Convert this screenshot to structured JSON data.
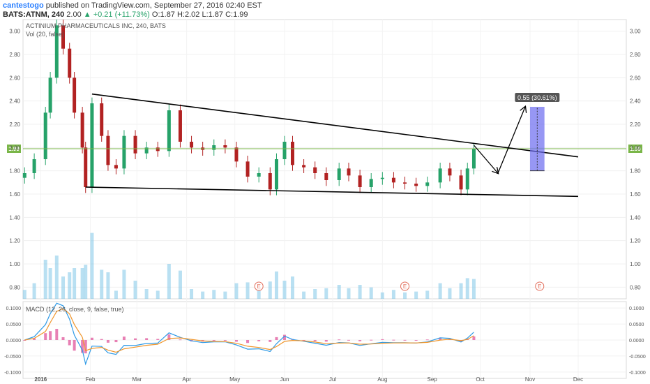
{
  "header": {
    "author": "cantestogo",
    "published": "published on TradingView.com, September 27, 2016 02:40 EST",
    "symbol": "BATS:ATNM, 240",
    "last": "2.00",
    "change": "▲ +0.21 (+11.73%)",
    "ohlc": "O:1.87 H:2.02 L:1.87 C:1.99"
  },
  "legend": {
    "main": "ACTINIUM PHARMACEUTICALS INC, 240, BATS",
    "volume": "Vol (20, false)",
    "macd": "MACD (12, 26, close, 9, false, true)"
  },
  "colors": {
    "up": "#26a269",
    "down": "#b22222",
    "volume": "#7fc6e8",
    "macd_line": "#2e9ae6",
    "signal_line": "#f0952a",
    "histogram": "#e0569b",
    "price_line": "#7ab648",
    "projection_box": "#6b6bf0",
    "trendline": "#000000",
    "earnings": "#e26d5a"
  },
  "chart_data": {
    "type": "candlestick",
    "symbol": "BATS:ATNM",
    "interval": "240",
    "x_ticks": [
      "2016",
      "Feb",
      "Mar",
      "Apr",
      "May",
      "Jun",
      "Jul",
      "Aug",
      "Sep",
      "Oct",
      "Nov",
      "Dec"
    ],
    "y_ticks": [
      0.8,
      1.0,
      1.2,
      1.4,
      1.6,
      1.8,
      2.0,
      2.2,
      2.4,
      2.6,
      2.8,
      3.0
    ],
    "ylim": [
      0.7,
      3.1
    ],
    "last_price_label": "1.99",
    "approx_closes": [
      {
        "date": "2015-12-22",
        "close": 1.78
      },
      {
        "date": "2015-12-28",
        "close": 1.9
      },
      {
        "date": "2016-01-04",
        "close": 2.3
      },
      {
        "date": "2016-01-07",
        "close": 2.6
      },
      {
        "date": "2016-01-11",
        "close": 3.05
      },
      {
        "date": "2016-01-15",
        "close": 2.85
      },
      {
        "date": "2016-01-19",
        "close": 2.6
      },
      {
        "date": "2016-01-22",
        "close": 2.3
      },
      {
        "date": "2016-01-27",
        "close": 2.0
      },
      {
        "date": "2016-01-29",
        "close": 1.66
      },
      {
        "date": "2016-02-02",
        "close": 2.38
      },
      {
        "date": "2016-02-08",
        "close": 2.1
      },
      {
        "date": "2016-02-12",
        "close": 1.85
      },
      {
        "date": "2016-02-17",
        "close": 1.82
      },
      {
        "date": "2016-02-22",
        "close": 2.1
      },
      {
        "date": "2016-02-29",
        "close": 1.95
      },
      {
        "date": "2016-03-07",
        "close": 2.0
      },
      {
        "date": "2016-03-14",
        "close": 1.97
      },
      {
        "date": "2016-03-21",
        "close": 2.32
      },
      {
        "date": "2016-03-28",
        "close": 2.05
      },
      {
        "date": "2016-04-04",
        "close": 2.0
      },
      {
        "date": "2016-04-11",
        "close": 1.98
      },
      {
        "date": "2016-04-18",
        "close": 2.02
      },
      {
        "date": "2016-04-25",
        "close": 2.0
      },
      {
        "date": "2016-05-02",
        "close": 1.88
      },
      {
        "date": "2016-05-09",
        "close": 1.75
      },
      {
        "date": "2016-05-16",
        "close": 1.78
      },
      {
        "date": "2016-05-23",
        "close": 1.64
      },
      {
        "date": "2016-05-27",
        "close": 1.9
      },
      {
        "date": "2016-06-01",
        "close": 2.05
      },
      {
        "date": "2016-06-06",
        "close": 1.85
      },
      {
        "date": "2016-06-13",
        "close": 1.83
      },
      {
        "date": "2016-06-20",
        "close": 1.78
      },
      {
        "date": "2016-06-27",
        "close": 1.72
      },
      {
        "date": "2016-07-05",
        "close": 1.82
      },
      {
        "date": "2016-07-11",
        "close": 1.76
      },
      {
        "date": "2016-07-18",
        "close": 1.66
      },
      {
        "date": "2016-07-25",
        "close": 1.73
      },
      {
        "date": "2016-08-01",
        "close": 1.74
      },
      {
        "date": "2016-08-08",
        "close": 1.7
      },
      {
        "date": "2016-08-15",
        "close": 1.69
      },
      {
        "date": "2016-08-22",
        "close": 1.67
      },
      {
        "date": "2016-08-29",
        "close": 1.7
      },
      {
        "date": "2016-09-06",
        "close": 1.82
      },
      {
        "date": "2016-09-12",
        "close": 1.76
      },
      {
        "date": "2016-09-19",
        "close": 1.64
      },
      {
        "date": "2016-09-23",
        "close": 1.82
      },
      {
        "date": "2016-09-27",
        "close": 1.99
      }
    ],
    "annotations": {
      "upper_trendline": [
        {
          "date": "2016-02-02",
          "price": 2.46
        },
        {
          "date": "2016-12-01",
          "price": 1.92
        }
      ],
      "lower_trendline": [
        {
          "date": "2016-01-29",
          "price": 1.66
        },
        {
          "date": "2016-12-01",
          "price": 1.58
        }
      ],
      "projected_path": [
        {
          "date": "2016-09-27",
          "price": 2.02
        },
        {
          "date": "2016-10-12",
          "price": 1.78
        },
        {
          "date": "2016-10-29",
          "price": 2.35
        }
      ],
      "projection_box": {
        "date_from": "2016-11-01",
        "date_to": "2016-11-10",
        "price_from": 1.8,
        "price_to": 2.35
      },
      "projection_label": "0.55 (30.61%)",
      "earnings_marker_text": "E",
      "earnings_dates": [
        "2016-05-16",
        "2016-08-15",
        "2016-11-07"
      ]
    },
    "volume": {
      "name": "Vol (20, false)",
      "yaxis_overlay": true
    },
    "macd": {
      "name": "MACD (12, 26, close, 9, false, true)",
      "y_ticks": [
        -0.1,
        -0.05,
        0,
        0.05,
        0.1
      ],
      "y_tick_labels": [
        "-0.1000",
        "-0.0500",
        "0.0000",
        "0.0500",
        "0.1000"
      ],
      "ylim": [
        -0.12,
        0.12
      ]
    }
  }
}
